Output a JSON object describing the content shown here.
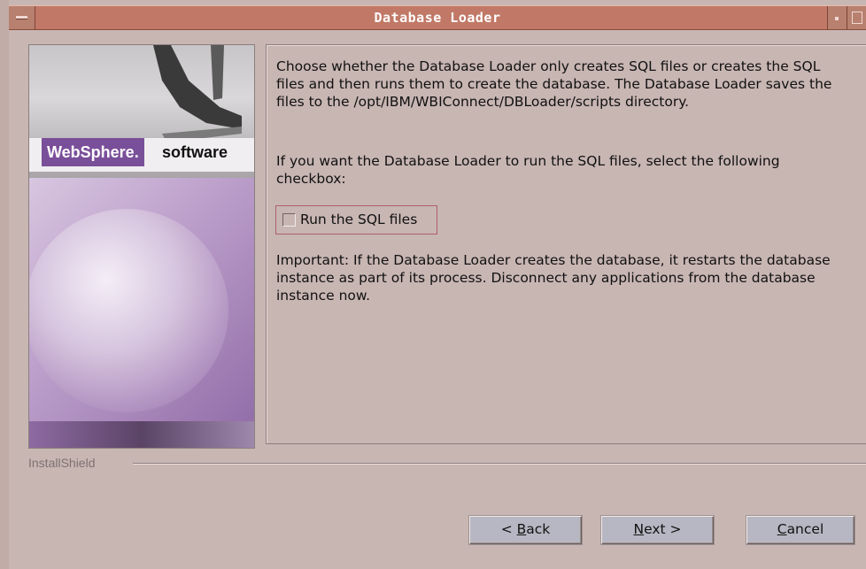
{
  "window": {
    "title": "Database Loader"
  },
  "side_image": {
    "logo_text": "WebSphere.",
    "logo_suffix": "software"
  },
  "content": {
    "paragraph_1": "Choose whether the Database Loader only creates SQL files or creates the SQL files and then runs them to create the database.  The Database Loader saves the files to the /opt/IBM/WBIConnect/DBLoader/scripts directory.",
    "paragraph_2": "If you want the Database Loader to run the SQL files, select the following checkbox:",
    "checkbox_label": "Run the SQL files",
    "checkbox_checked": false,
    "paragraph_3": "Important: If the Database Loader creates the database, it restarts the database instance as part of its process.  Disconnect any applications from the database instance now."
  },
  "footer": {
    "brand": "InstallShield"
  },
  "buttons": {
    "back_prefix": "< ",
    "back_mnemonic": "B",
    "back_rest": "ack",
    "next_mnemonic": "N",
    "next_rest": "ext >",
    "cancel_mnemonic": "C",
    "cancel_rest": "ancel"
  },
  "colors": {
    "titlebar": "#c17866",
    "background": "#c8b6b3",
    "button": "#b7b7c3",
    "checkbox_focus_border": "#b0606a"
  }
}
